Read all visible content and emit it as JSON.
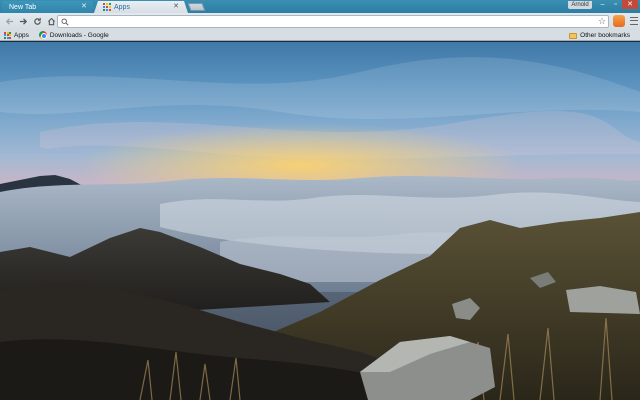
{
  "browser": {
    "tabs": [
      {
        "label": "New Tab",
        "active": false
      },
      {
        "label": "Apps",
        "active": true
      }
    ],
    "profile_name": "Arnold",
    "window_controls": [
      "minimize",
      "maximize",
      "close"
    ]
  },
  "toolbar": {
    "omnibox": {
      "value": "",
      "placeholder": ""
    }
  },
  "bookmarks_bar": {
    "items": [
      {
        "label": "Apps",
        "icon": "apps-grid-icon"
      },
      {
        "label": "Downloads - Google",
        "icon": "chrome-icon"
      }
    ],
    "other": {
      "label": "Other bookmarks",
      "icon": "folder-icon"
    }
  },
  "colors": {
    "tabstrip": "#2c7ea3",
    "toolbar": "#dbe2e8",
    "sunset_glow": "#f6b252",
    "close_button": "#c24a3b"
  }
}
